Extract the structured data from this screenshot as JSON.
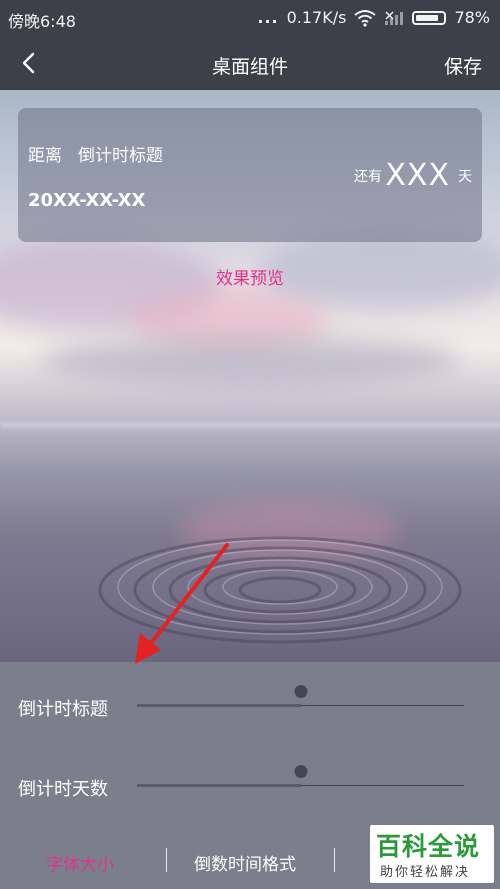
{
  "status_bar": {
    "time": "傍晚6:48",
    "dots": "...",
    "speed": "0.17K/s",
    "battery_percent": "78%",
    "icons": [
      "wifi-icon",
      "signal-icon",
      "battery-icon"
    ]
  },
  "nav": {
    "back_icon": "chevron-left-icon",
    "title": "桌面组件",
    "save_label": "保存"
  },
  "widget": {
    "distance_label": "距离",
    "title": "倒计时标题",
    "date": "20XX-XX-XX",
    "still_label": "还有",
    "days_value": "XXX",
    "day_unit": "天"
  },
  "preview_label": "效果预览",
  "settings": {
    "title_row": {
      "label": "倒计时标题",
      "value": 0.5
    },
    "days_row": {
      "label": "倒计时天数",
      "value": 0.5
    }
  },
  "tabs": [
    {
      "label": "字体大小",
      "active": true
    },
    {
      "label": "倒数时间格式",
      "active": false
    }
  ],
  "watermark": {
    "main": "百科全说",
    "sub": "助你轻松解决"
  },
  "colors": {
    "accent": "#e0338a",
    "bar": "#3e4049",
    "panel": "#7b7f8c",
    "annotation_arrow": "#e52222",
    "watermark_text": "#2a9a3a"
  }
}
